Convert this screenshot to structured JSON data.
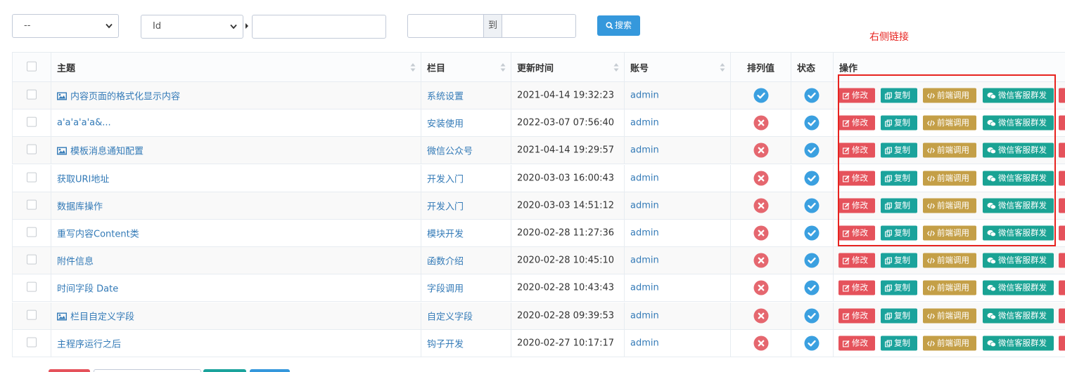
{
  "filters": {
    "field_select": "--",
    "column_select": "Id",
    "keyword_value": "",
    "range_separator": "到",
    "search_label": "搜索"
  },
  "annotation": {
    "label": "右侧链接"
  },
  "table": {
    "headers": {
      "subject": "主题",
      "column": "栏目",
      "updated": "更新时间",
      "account": "账号",
      "order": "排列值",
      "status": "状态",
      "actions": "操作"
    },
    "action_labels": {
      "edit": "修改",
      "copy": "复制",
      "api": "前端调用",
      "wechat": "微信客服群发"
    },
    "rows": [
      {
        "subject": "内容页面的格式化显示内容",
        "has_image": true,
        "column": "系统设置",
        "updated": "2021-04-14 19:32:23",
        "account": "admin",
        "order_ok": true,
        "status_ok": true
      },
      {
        "subject": "a'a'a'a'a&...",
        "has_image": false,
        "column": "安装使用",
        "updated": "2022-03-07 07:56:40",
        "account": "admin",
        "order_ok": false,
        "status_ok": true
      },
      {
        "subject": "模板消息通知配置",
        "has_image": true,
        "column": "微信公众号",
        "updated": "2021-04-14 19:29:57",
        "account": "admin",
        "order_ok": false,
        "status_ok": true
      },
      {
        "subject": "获取URI地址",
        "has_image": false,
        "column": "开发入门",
        "updated": "2020-03-03 16:00:43",
        "account": "admin",
        "order_ok": false,
        "status_ok": true
      },
      {
        "subject": "数据库操作",
        "has_image": false,
        "column": "开发入门",
        "updated": "2020-03-03 14:51:12",
        "account": "admin",
        "order_ok": false,
        "status_ok": true
      },
      {
        "subject": "重写内容Content类",
        "has_image": false,
        "column": "模块开发",
        "updated": "2020-02-28 11:27:36",
        "account": "admin",
        "order_ok": false,
        "status_ok": true
      },
      {
        "subject": "附件信息",
        "has_image": false,
        "column": "函数介绍",
        "updated": "2020-02-28 10:45:10",
        "account": "admin",
        "order_ok": false,
        "status_ok": true
      },
      {
        "subject": "时间字段 Date",
        "has_image": false,
        "column": "字段调用",
        "updated": "2020-02-28 10:43:43",
        "account": "admin",
        "order_ok": false,
        "status_ok": true
      },
      {
        "subject": "栏目自定义字段",
        "has_image": true,
        "column": "自定义字段",
        "updated": "2020-02-28 09:39:53",
        "account": "admin",
        "order_ok": false,
        "status_ok": true
      },
      {
        "subject": "主程序运行之后",
        "has_image": false,
        "column": "钩子开发",
        "updated": "2020-02-27 10:17:17",
        "account": "admin",
        "order_ok": false,
        "status_ok": true
      }
    ]
  },
  "colors": {
    "primary": "#3598dc",
    "danger": "#e5525b",
    "success": "#1ba39c",
    "warning": "#c49f47",
    "link": "#337ab7",
    "annotation": "#e7231f"
  },
  "icons": {
    "search": "search-icon",
    "image": "image-icon",
    "edit": "edit-icon",
    "copy": "copy-icon",
    "code": "code-icon",
    "wechat": "wechat-icon",
    "check": "check-circle-icon",
    "cross": "times-circle-icon"
  }
}
